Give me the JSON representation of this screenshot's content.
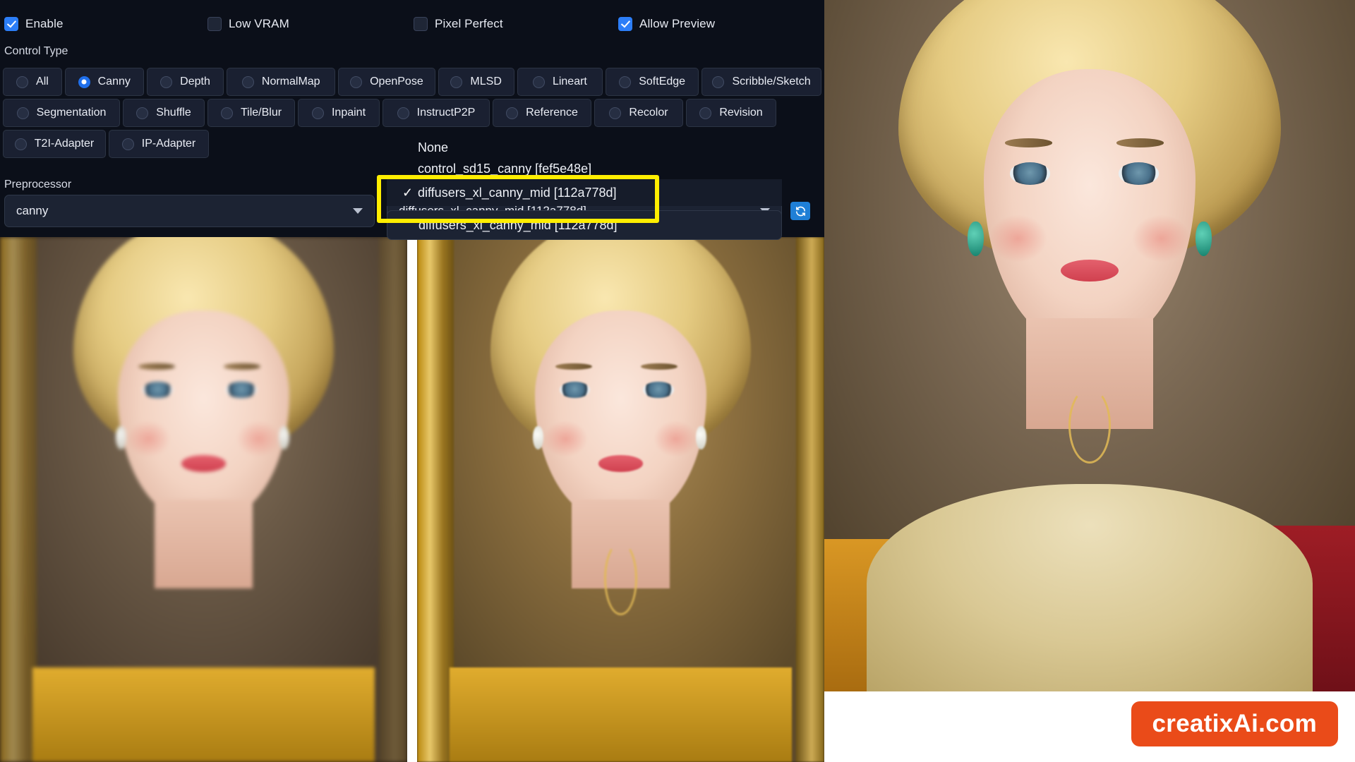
{
  "panel": {
    "checkboxes": [
      {
        "label": "Enable",
        "checked": true,
        "icon": "checkbox-icon"
      },
      {
        "label": "Low VRAM",
        "checked": false,
        "icon": "checkbox-icon"
      },
      {
        "label": "Pixel Perfect",
        "checked": false,
        "icon": "checkbox-icon"
      },
      {
        "label": "Allow Preview",
        "checked": true,
        "icon": "checkbox-icon"
      }
    ],
    "control_type_label": "Control Type",
    "control_types": [
      {
        "label": "All",
        "selected": false
      },
      {
        "label": "Canny",
        "selected": true
      },
      {
        "label": "Depth",
        "selected": false
      },
      {
        "label": "NormalMap",
        "selected": false
      },
      {
        "label": "OpenPose",
        "selected": false
      },
      {
        "label": "MLSD",
        "selected": false
      },
      {
        "label": "Lineart",
        "selected": false
      },
      {
        "label": "SoftEdge",
        "selected": false
      },
      {
        "label": "Scribble/Sketch",
        "selected": false
      },
      {
        "label": "Segmentation",
        "selected": false
      },
      {
        "label": "Shuffle",
        "selected": false
      },
      {
        "label": "Tile/Blur",
        "selected": false
      },
      {
        "label": "Inpaint",
        "selected": false
      },
      {
        "label": "InstructP2P",
        "selected": false
      },
      {
        "label": "Reference",
        "selected": false
      },
      {
        "label": "Recolor",
        "selected": false
      },
      {
        "label": "Revision",
        "selected": false
      },
      {
        "label": "T2I-Adapter",
        "selected": false
      },
      {
        "label": "IP-Adapter",
        "selected": false
      }
    ],
    "preprocessor": {
      "label": "Preprocessor",
      "value": "canny",
      "caret_icon": "chevron-down-icon"
    },
    "model": {
      "value": "diffusers_xl_canny_mid [112a778d]",
      "caret_icon": "chevron-down-icon",
      "refresh_icon": "refresh-icon"
    },
    "dropdown": {
      "options": [
        {
          "label": "None",
          "checked": false
        },
        {
          "label": "control_sd15_canny [fef5e48e]",
          "checked": false
        },
        {
          "label": "diffusers_xl_canny_mid [112a778d]",
          "checked": true
        }
      ],
      "check_glyph": "✓",
      "echo_option": "diffusers_xl_canny_mid [112a778d]",
      "highlight_color": "#ffee00"
    }
  },
  "colors": {
    "panel_bg": "#0b0f19",
    "accent_blue": "#2c7ef8",
    "radio_selected": "#1f6feb",
    "highlight_yellow": "#ffee00",
    "watermark_orange": "#ea4b19"
  },
  "images": [
    {
      "name": "preview-thumbnail-left",
      "alt": "Blonde woman classical portrait, soft focus preview"
    },
    {
      "name": "preview-thumbnail-right",
      "alt": "Blonde woman classical portrait with gold necklace in ornate frame"
    },
    {
      "name": "hero-result-image",
      "alt": "Blonde woman oil painting portrait with fur collar and emerald earrings"
    }
  ],
  "watermark": {
    "text": "creatixAi.com"
  }
}
